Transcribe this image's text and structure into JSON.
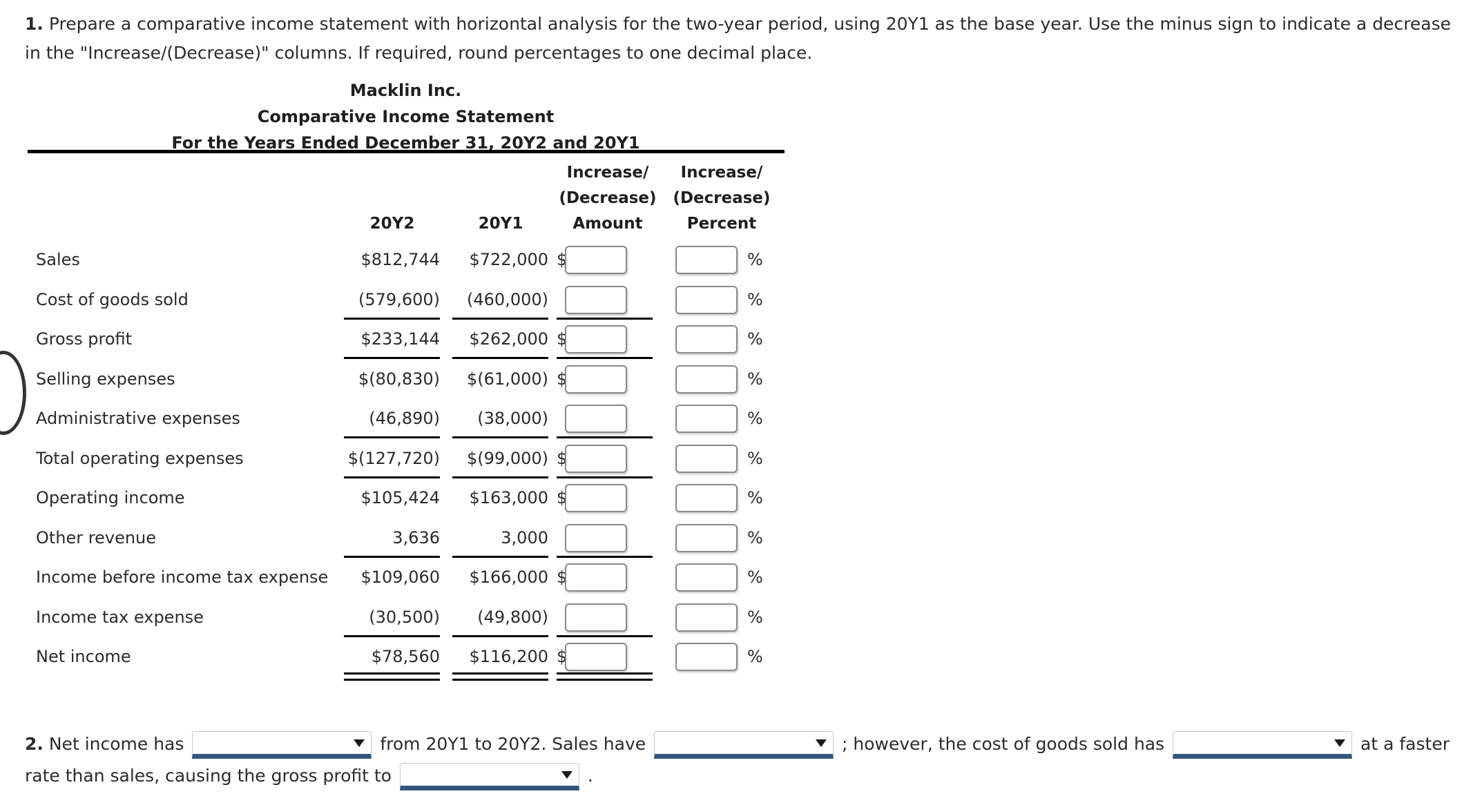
{
  "question1": {
    "number": "1.",
    "text": "Prepare a comparative income statement with horizontal analysis for the two-year period, using 20Y1 as the base year. Use the minus sign to indicate a decrease in the \"Increase/(Decrease)\" columns. If required, round percentages to one decimal place."
  },
  "statement": {
    "company": "Macklin Inc.",
    "title": "Comparative Income Statement",
    "period": "For the Years Ended December 31, 20Y2 and 20Y1",
    "columns": {
      "year_current": "20Y2",
      "year_base": "20Y1",
      "increase_line1": "Increase/",
      "increase_line2": "(Decrease)",
      "amount": "Amount",
      "percent": "Percent"
    },
    "symbols": {
      "dollar": "$",
      "percent": "%"
    },
    "rows": [
      {
        "label": "Sales",
        "y2": "$812,744",
        "y1": "$722,000",
        "dollar": true,
        "rule": "none",
        "amount_value": "",
        "percent_value": ""
      },
      {
        "label": "Cost of goods sold",
        "y2": "(579,600)",
        "y1": "(460,000)",
        "dollar": false,
        "rule": "single",
        "amount_value": "",
        "percent_value": ""
      },
      {
        "label": "Gross profit",
        "y2": "$233,144",
        "y1": "$262,000",
        "dollar": true,
        "rule": "single",
        "amount_value": "",
        "percent_value": ""
      },
      {
        "label": "Selling expenses",
        "y2": "$(80,830)",
        "y1": "$(61,000)",
        "dollar": true,
        "rule": "none",
        "amount_value": "",
        "percent_value": ""
      },
      {
        "label": "Administrative expenses",
        "y2": "(46,890)",
        "y1": "(38,000)",
        "dollar": false,
        "rule": "single",
        "amount_value": "",
        "percent_value": ""
      },
      {
        "label": "Total operating expenses",
        "y2": "$(127,720)",
        "y1": "$(99,000)",
        "dollar": true,
        "rule": "single",
        "amount_value": "",
        "percent_value": ""
      },
      {
        "label": "Operating income",
        "y2": "$105,424",
        "y1": "$163,000",
        "dollar": true,
        "rule": "none",
        "amount_value": "",
        "percent_value": ""
      },
      {
        "label": "Other revenue",
        "y2": "3,636",
        "y1": "3,000",
        "dollar": false,
        "rule": "single",
        "amount_value": "",
        "percent_value": ""
      },
      {
        "label": "Income before income tax expense",
        "y2": "$109,060",
        "y1": "$166,000",
        "dollar": true,
        "rule": "none",
        "amount_value": "",
        "percent_value": ""
      },
      {
        "label": "Income tax expense",
        "y2": "(30,500)",
        "y1": "(49,800)",
        "dollar": false,
        "rule": "single",
        "amount_value": "",
        "percent_value": ""
      },
      {
        "label": "Net income",
        "y2": "$78,560",
        "y1": "$116,200",
        "dollar": true,
        "rule": "double",
        "amount_value": "",
        "percent_value": ""
      }
    ]
  },
  "question2": {
    "number": "2.",
    "seg1": "Net income has",
    "seg2": "from 20Y1 to 20Y2. Sales have",
    "seg3": "; however, the cost of goods sold has",
    "seg4": "at a faster",
    "seg5": "rate than sales, causing the gross profit to",
    "seg6": ".",
    "dropdowns": [
      {
        "name": "net-income-change",
        "value": ""
      },
      {
        "name": "sales-change",
        "value": ""
      },
      {
        "name": "cogs-change",
        "value": ""
      },
      {
        "name": "gross-profit-change",
        "value": ""
      }
    ]
  },
  "colors": {
    "rule": "#000000",
    "text": "#2b2b2b",
    "dropdown_underline": "#31577f",
    "input_border": "#8a8a8a"
  }
}
